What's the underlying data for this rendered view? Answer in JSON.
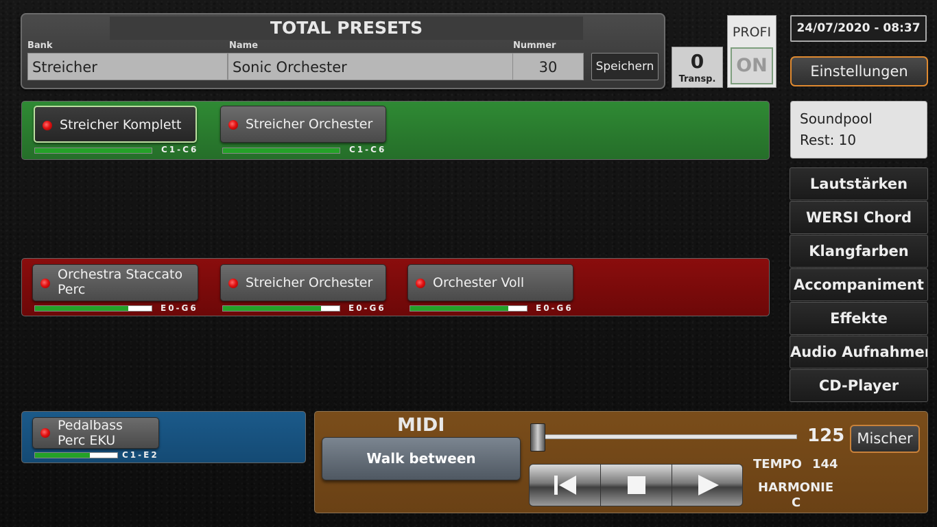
{
  "preset": {
    "title": "TOTAL PRESETS",
    "bank_label": "Bank",
    "bank_value": "Streicher",
    "name_label": "Name",
    "name_value": "Sonic Orchester",
    "number_label": "Nummer",
    "number_value": "30",
    "save_label": "Speichern"
  },
  "transpose": {
    "value": "0",
    "label": "Transp."
  },
  "profi": {
    "label": "PROFI",
    "toggle": "ON"
  },
  "datetime": "24/07/2020 - 08:37",
  "settings_label": "Einstellungen",
  "soundpool": {
    "line1": "Soundpool",
    "line2": "Rest: 10"
  },
  "nav": [
    "Lautstärken",
    "WERSI Chord",
    "Klangfarben",
    "Accompaniment",
    "Effekte",
    "Audio Aufnahmen",
    "CD-Player"
  ],
  "rows": {
    "upper": {
      "color": "#2f8a34",
      "voices": [
        {
          "name": "Streicher Komplett",
          "range": "C1-C6",
          "volume": 1.0,
          "active": true
        },
        {
          "name": "Streicher Orchester",
          "range": "C1-C6",
          "volume": 1.0,
          "active": false
        }
      ]
    },
    "lower": {
      "color": "#8a0d0d",
      "voices": [
        {
          "name": "Orchestra Staccato Perc",
          "range": "E0-G6",
          "volume": 0.8,
          "active": false
        },
        {
          "name": "Streicher Orchester",
          "range": "E0-G6",
          "volume": 0.84,
          "active": false
        },
        {
          "name": "Orchester Voll",
          "range": "E0-G6",
          "volume": 0.84,
          "active": false
        }
      ]
    },
    "pedal": {
      "color": "#1b5a8a",
      "voices": [
        {
          "name": "Pedalbass Perc EKU",
          "range": "C1-E2",
          "volume": 0.67,
          "active": false
        }
      ]
    }
  },
  "player": {
    "midi_label": "MIDI",
    "style_name": "Walk between",
    "slider_value": "125",
    "mixer_label": "Mischer",
    "tempo_label": "TEMPO",
    "tempo_value": "144",
    "harmony_label": "HARMONIE",
    "harmony_value": "C",
    "transport_icons": [
      "skip-back-icon",
      "stop-icon",
      "play-icon"
    ]
  }
}
